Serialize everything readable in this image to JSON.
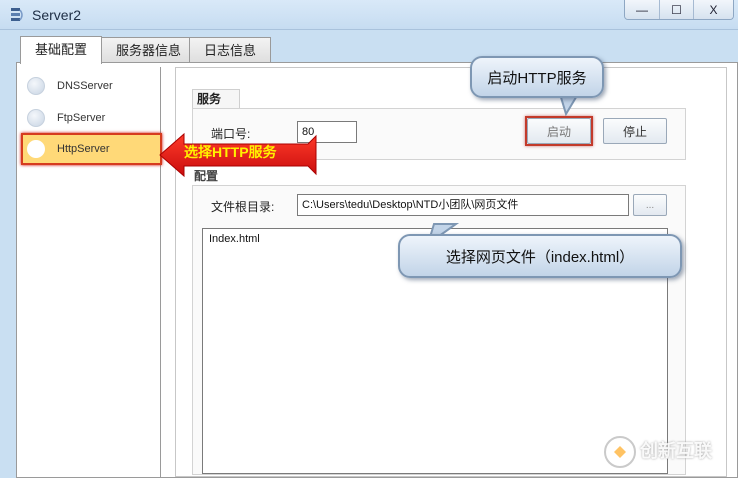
{
  "window": {
    "title": "Server2",
    "controls": {
      "minimize": "—",
      "maximize": "☐",
      "close": "X"
    }
  },
  "tabs": [
    {
      "label": "基础配置",
      "active": true
    },
    {
      "label": "服务器信息",
      "active": false
    },
    {
      "label": "日志信息",
      "active": false
    }
  ],
  "servers": [
    {
      "label": "DNSServer",
      "selected": false
    },
    {
      "label": "FtpServer",
      "selected": false
    },
    {
      "label": "HttpServer",
      "selected": true
    }
  ],
  "service_group": {
    "title": "服务",
    "port_label": "端口号:",
    "port_value": "80",
    "start_button": "启动",
    "stop_button": "停止"
  },
  "config_group": {
    "title": "配置",
    "root_dir_label": "文件根目录:",
    "root_dir_value": "C:\\Users\\tedu\\Desktop\\NTD小团队\\网页文件",
    "browse_button": "...",
    "files": [
      "Index.html"
    ]
  },
  "annotations": {
    "start_http": "启动HTTP服务",
    "select_http": "选择HTTP服务",
    "select_file": "选择网页文件（index.html）"
  },
  "watermark": {
    "text": "创新互联"
  },
  "colors": {
    "accent_red": "#d63b1e",
    "selected_bg": "#ffd978",
    "arrow_text": "#fff200"
  }
}
